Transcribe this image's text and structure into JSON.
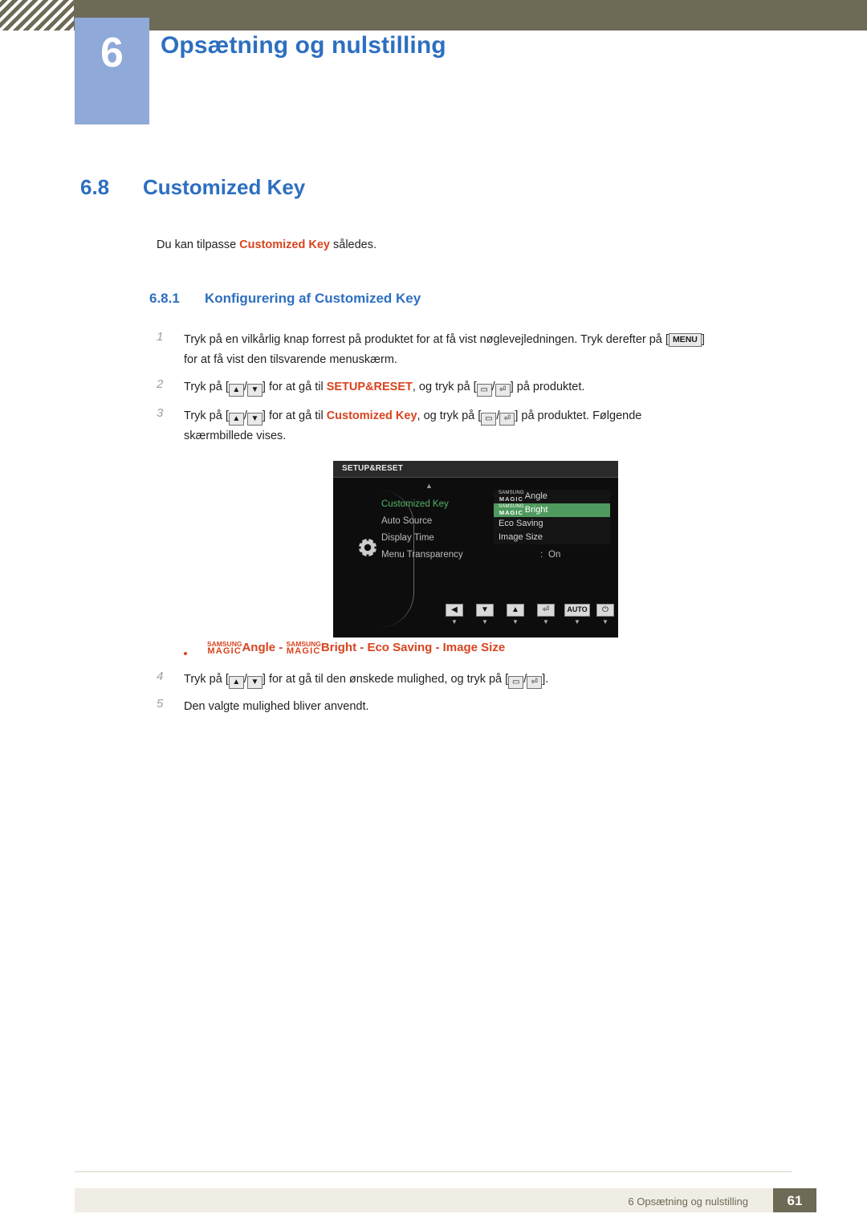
{
  "header": {
    "chapter_number": "6",
    "chapter_title": "Opsætning og nulstilling"
  },
  "section": {
    "number": "6.8",
    "title": "Customized Key",
    "intro_before": "Du kan tilpasse ",
    "intro_keyword": "Customized Key",
    "intro_after": " således.",
    "subsection_number": "6.8.1",
    "subsection_title": "Konfigurering af Customized Key"
  },
  "steps": [
    {
      "n": "1",
      "text_a": "Tryk på en vilkårlig knap forrest på produktet for at få vist nøglevejledningen. Tryk derefter på [",
      "key": "MENU",
      "text_b": "]",
      "line2": "for at få vist den tilsvarende menuskærm."
    },
    {
      "n": "2",
      "text_a": "Tryk på [",
      "up": "▲",
      "slash": "/",
      "down": "▼",
      "text_b": "] for at gå til ",
      "kw": "SETUP&RESET",
      "text_c": ", og tryk på [",
      "g1": "▭",
      "g2": "⏎",
      "text_d": "] på produktet."
    },
    {
      "n": "3",
      "text_a": "Tryk på [",
      "up": "▲",
      "slash": "/",
      "down": "▼",
      "text_b": "] for at gå til ",
      "kw": "Customized Key",
      "text_c": ", og tryk på [",
      "g1": "▭",
      "g2": "⏎",
      "text_d": "] på produktet. Følgende",
      "line2": "skærmbillede vises."
    },
    {
      "n": "4",
      "text_a": "Tryk på [",
      "up": "▲",
      "slash": "/",
      "down": "▼",
      "text_b": "] for at gå til den ønskede mulighed, og tryk på [",
      "g1": "▭",
      "g2": "⏎",
      "text_d": "]."
    },
    {
      "n": "5",
      "text_a": "Den valgte mulighed bliver anvendt."
    }
  ],
  "bullet": {
    "magic_top": "SAMSUNG",
    "magic_bottom": "MAGIC",
    "item1": "Angle",
    "sep1": " - ",
    "item2": "Bright",
    "sep2": " - ",
    "item3": "Eco Saving",
    "sep3": " - ",
    "item4": "Image Size"
  },
  "osd": {
    "title": "SETUP&RESET",
    "menu": [
      {
        "label": "Customized Key",
        "selected": true,
        "colon": ":"
      },
      {
        "label": "Auto Source",
        "selected": false,
        "colon": ":"
      },
      {
        "label": "Display Time",
        "selected": false,
        "colon": ":"
      },
      {
        "label": "Menu Transparency",
        "selected": false,
        "colon": ":",
        "value": "On"
      }
    ],
    "submenu": [
      {
        "label": "Angle",
        "magic_top": "SAMSUNG",
        "magic_bottom": "MAGIC",
        "highlighted": false
      },
      {
        "label": "Bright",
        "magic_top": "SAMSUNG",
        "magic_bottom": "MAGIC",
        "highlighted": true
      },
      {
        "label": "Eco Saving",
        "highlighted": false
      },
      {
        "label": "Image Size",
        "highlighted": false
      }
    ],
    "buttons": [
      {
        "icon": "◀",
        "sub": "▼"
      },
      {
        "icon": "▼",
        "sub": "▼"
      },
      {
        "icon": "▲",
        "sub": "▼"
      },
      {
        "icon": "⏎",
        "sub": "▼"
      },
      {
        "icon": "AUTO",
        "sub": "▼"
      },
      {
        "icon": "⏻",
        "sub": "▼"
      }
    ]
  },
  "footer": {
    "text": "6 Opsætning og nulstilling",
    "page": "61"
  },
  "colors": {
    "accent_blue": "#2d6fc0",
    "chapter_box": "#8fa9d8",
    "olive": "#6d6a56",
    "keyword_red": "#d8441f",
    "osd_green": "#4f9a5e"
  }
}
